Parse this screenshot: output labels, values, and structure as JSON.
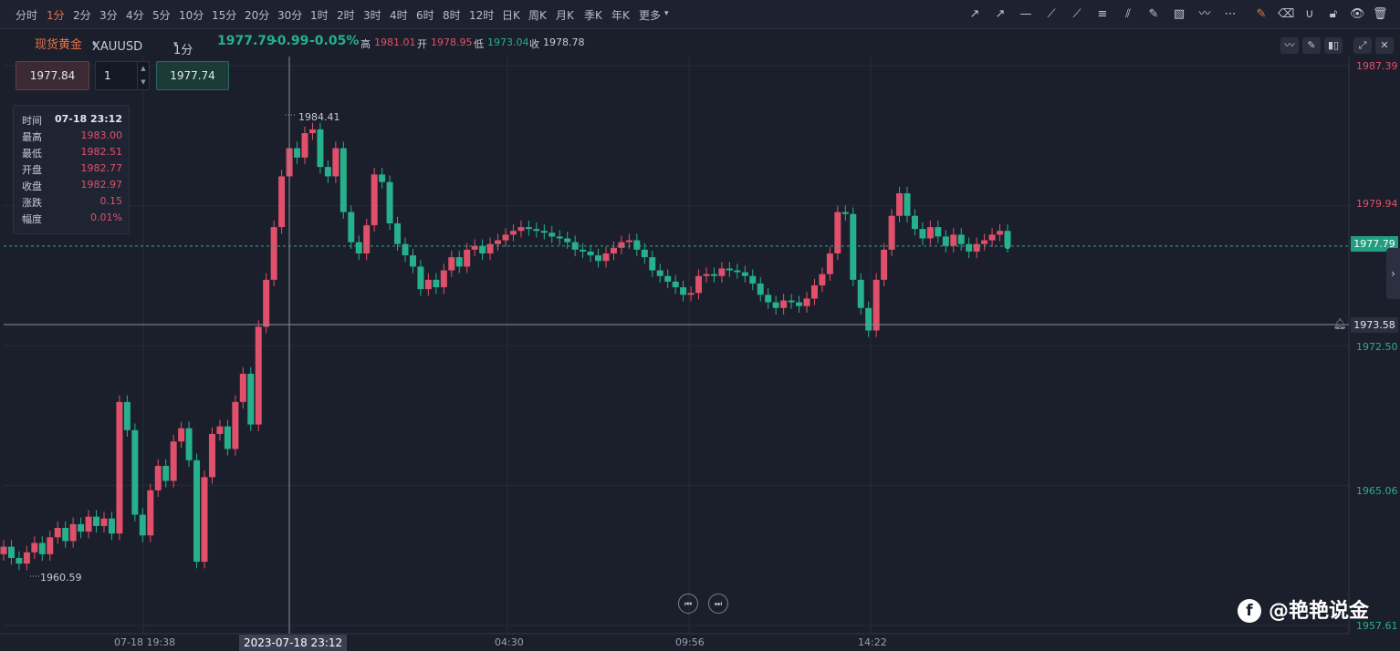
{
  "toolbar": {
    "timeframes": [
      "分时",
      "1分",
      "2分",
      "3分",
      "4分",
      "5分",
      "10分",
      "15分",
      "20分",
      "30分",
      "1时",
      "2时",
      "3时",
      "4时",
      "6时",
      "8时",
      "12时",
      "日K",
      "周K",
      "月K",
      "季K",
      "年K",
      "更多"
    ],
    "active_timeframe": "1分",
    "tools": [
      "trend-line-icon",
      "ray-icon",
      "horizontal-line-icon",
      "segment-icon",
      "pencil-line-icon",
      "fibonacci-icon",
      "fan-icon",
      "brush-icon",
      "image-icon",
      "pattern-icon",
      "more-dots-icon",
      "edit-icon",
      "eraser-icon",
      "magnet-icon",
      "lock-icon",
      "eye-icon",
      "trash-icon"
    ]
  },
  "symbol": {
    "name": "现货黄金",
    "code": "XAUUSD",
    "timeframe": "1分",
    "price": "1977.79",
    "change": "-0.99",
    "change_pct": "-0.05%",
    "high_label": "高",
    "high": "1981.01",
    "open_label": "开",
    "open": "1978.95",
    "low_label": "低",
    "low": "1973.04",
    "close_label": "收",
    "close": "1978.78"
  },
  "order": {
    "sell": "1977.84",
    "qty": "1",
    "buy": "1977.74"
  },
  "tooltip": {
    "rows": [
      {
        "k": "时间",
        "v": "07-18 23:12"
      },
      {
        "k": "最高",
        "v": "1983.00"
      },
      {
        "k": "最低",
        "v": "1982.51"
      },
      {
        "k": "开盘",
        "v": "1982.77"
      },
      {
        "k": "收盘",
        "v": "1982.97"
      },
      {
        "k": "涨跌",
        "v": "0.15"
      },
      {
        "k": "幅度",
        "v": "0.01%"
      }
    ]
  },
  "y_axis": {
    "ticks": [
      "1987.39",
      "1979.94",
      "1972.50",
      "1965.06",
      "1957.61"
    ],
    "current_price": "1977.79",
    "crosshair_price": "1973.58"
  },
  "x_axis": {
    "ticks": [
      "07-18 19:38",
      "04:30",
      "09:56",
      "14:22"
    ],
    "crosshair_label": "2023-07-18 23:12"
  },
  "annotations": {
    "max_label": "1984.41",
    "min_label": "1960.59"
  },
  "watermark": "@艳艳说金",
  "colors": {
    "up": "#e0506a",
    "down": "#26b08c",
    "accent": "#e8734a",
    "bg": "#1b1f2b"
  },
  "chart_data": {
    "type": "candlestick",
    "series": [
      {
        "name": "XAUUSD",
        "close": [
          1961.8,
          1961.2,
          1960.9,
          1961.5,
          1962.0,
          1961.4,
          1962.3,
          1962.8,
          1962.1,
          1963.0,
          1962.6,
          1963.4,
          1962.9,
          1963.3,
          1962.5,
          1969.5,
          1968.0,
          1963.5,
          1962.4,
          1964.8,
          1966.1,
          1965.3,
          1967.4,
          1968.1,
          1966.4,
          1961.0,
          1965.5,
          1967.8,
          1968.2,
          1967.0,
          1969.5,
          1971.0,
          1968.3,
          1973.5,
          1976.0,
          1978.8,
          1981.5,
          1983.0,
          1982.5,
          1983.8,
          1984.0,
          1982.0,
          1981.5,
          1983.0,
          1979.6,
          1978.0,
          1977.4,
          1978.9,
          1981.6,
          1981.2,
          1979.0,
          1977.9,
          1977.3,
          1976.7,
          1975.5,
          1976.0,
          1975.6,
          1976.5,
          1977.2,
          1976.7,
          1977.6,
          1977.8,
          1977.4,
          1977.9,
          1978.1,
          1978.4,
          1978.6,
          1978.8,
          1978.7,
          1978.6,
          1978.5,
          1978.3,
          1978.2,
          1978.0,
          1977.6,
          1977.5,
          1977.3,
          1977.0,
          1977.4,
          1977.7,
          1978.0,
          1978.1,
          1977.6,
          1977.2,
          1976.5,
          1976.2,
          1975.9,
          1975.6,
          1975.2,
          1975.3,
          1976.2,
          1976.3,
          1976.2,
          1976.6,
          1976.5,
          1976.4,
          1976.2,
          1975.8,
          1975.2,
          1974.8,
          1974.5,
          1974.9,
          1974.8,
          1974.6,
          1975.0,
          1975.7,
          1976.3,
          1977.4,
          1979.6,
          1979.5,
          1976.0,
          1974.5,
          1973.3,
          1976.0,
          1977.6,
          1979.4,
          1980.6,
          1979.4,
          1978.7,
          1978.2,
          1978.8,
          1978.3,
          1977.8,
          1978.4,
          1977.9,
          1977.5,
          1977.9,
          1978.1,
          1978.4,
          1978.6,
          1977.8
        ]
      }
    ],
    "x_ticks": [
      "07-18 19:38",
      "04:30",
      "09:56",
      "14:22"
    ],
    "ylim": [
      1957.61,
      1987.39
    ],
    "y_ticks": [
      1987.39,
      1979.94,
      1972.5,
      1965.06,
      1957.61
    ],
    "current_price": 1977.79,
    "max_marker": 1984.41,
    "min_marker": 1960.59
  }
}
